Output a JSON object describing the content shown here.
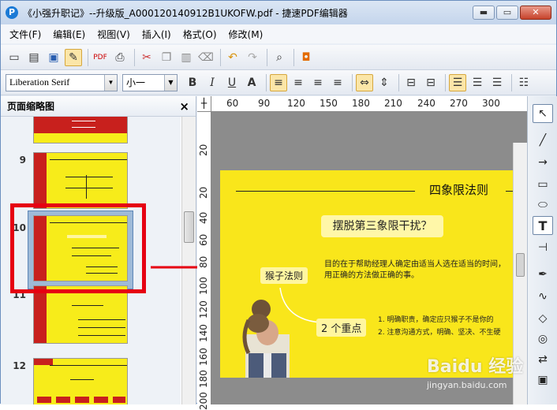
{
  "window": {
    "title": "《小强升职记》--升级版_A000120140912B1UKOFW.pdf - 捷速PDF编辑器",
    "app_icon": "P",
    "buttons": {
      "minimize": "▬",
      "maximize": "▭",
      "close": "✕"
    }
  },
  "menu": [
    "文件(F)",
    "编辑(E)",
    "视图(V)",
    "插入(I)",
    "格式(O)",
    "修改(M)"
  ],
  "toolbar_icons": [
    "new-file-icon",
    "open-folder-icon",
    "save-icon",
    "edit-pen-icon",
    "pdf-export-icon",
    "print-icon",
    "cut-icon",
    "copy-icon",
    "paste-icon",
    "clear-icon",
    "undo-icon",
    "redo-icon",
    "search-zoom-icon",
    "bag-icon"
  ],
  "format_bar": {
    "font": "Liberation Serif",
    "size": "小一",
    "bold": "B",
    "italic": "I",
    "underline": "U",
    "outline": "A"
  },
  "sidebar": {
    "title": "页面缩略图",
    "close": "×",
    "pages": [
      "9",
      "10",
      "11",
      "12"
    ]
  },
  "ruler": {
    "horizontal": [
      "60",
      "90",
      "120",
      "150",
      "180",
      "210",
      "240",
      "270",
      "300"
    ],
    "vertical": [
      "20",
      "20",
      "40",
      "60",
      "80",
      "100",
      "120",
      "140",
      "160",
      "180",
      "200"
    ]
  },
  "slide": {
    "title": "四象限法则",
    "bubble": "摆脱第三象限干扰？",
    "label1": "猴子法则",
    "desc_line1": "目的在于帮助经理人确定由适当人选在适当的时间，",
    "desc_line2": "用正确的方法做正确的事。",
    "label2": "2 个重点",
    "list1": "1.   明确职责，确定应只猴子不是你的",
    "list2": "2.   注意沟通方式，明确、坚决、不生硬"
  },
  "watermark": {
    "main": "Baidu 经验",
    "sub": "jingyan.baidu.com"
  },
  "colors": {
    "slide_yellow": "#f9e61b",
    "accent_red": "#c8201d",
    "highlight": "#e60012"
  }
}
